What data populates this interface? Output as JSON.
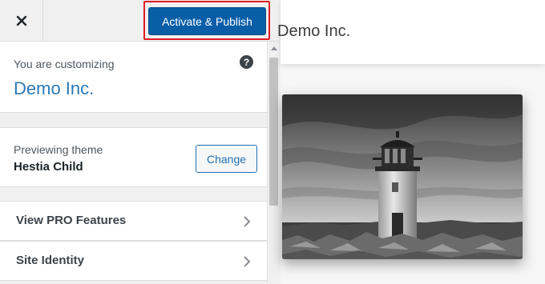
{
  "topbar": {
    "close_label": "×",
    "publish_label": "Activate & Publish"
  },
  "customizing": {
    "label": "You are customizing",
    "site_title": "Demo Inc.",
    "help_icon": "?"
  },
  "theme": {
    "label": "Previewing theme",
    "name": "Hestia Child",
    "change_label": "Change"
  },
  "sections": [
    {
      "label": "View PRO Features"
    },
    {
      "label": "Site Identity"
    }
  ],
  "preview": {
    "brand": "Demo Inc."
  },
  "colors": {
    "primary": "#0a5ea8",
    "highlight": "#e01b24",
    "link": "#2c79b6"
  }
}
